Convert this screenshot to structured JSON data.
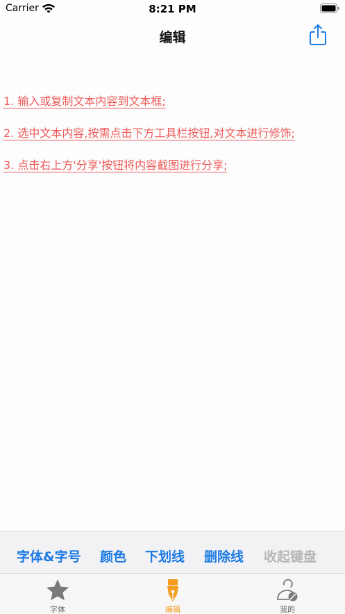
{
  "status_bar": {
    "carrier": "Carrier",
    "time": "8:21 PM",
    "wifi_icon": "wifi-icon",
    "battery_icon": "battery-icon"
  },
  "nav": {
    "title": "编辑",
    "share_icon": "share-icon"
  },
  "content": {
    "lines": [
      "1. 输入或复制文本内容到文本框;",
      "2. 选中文本内容,按需点击下方工具栏按钮,对文本进行修饰;",
      "3. 点击右上方'分享'按钮将内容截图进行分享;"
    ],
    "text_color": "#ee5a5a"
  },
  "toolbar": {
    "font_size": "字体&字号",
    "color": "颜色",
    "underline": "下划线",
    "strikethrough": "删除线",
    "dismiss_keyboard": "收起键盘",
    "accent": "#1c7ae4",
    "disabled": "#b7b7b9"
  },
  "tabs": [
    {
      "label": "字体",
      "icon": "star-icon",
      "selected": false
    },
    {
      "label": "编辑",
      "icon": "pen-icon",
      "selected": true
    },
    {
      "label": "我的",
      "icon": "user-icon",
      "selected": false
    }
  ],
  "colors": {
    "selected_tab": "#f39c1f",
    "unselected_tab": "#7a7a7a"
  }
}
